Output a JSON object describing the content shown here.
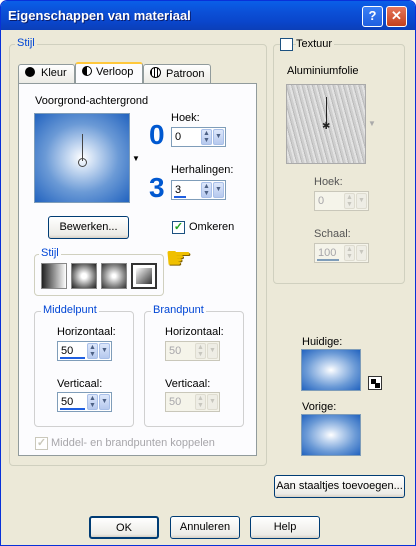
{
  "window": {
    "title": "Eigenschappen van materiaal",
    "help": "?",
    "close": "✕"
  },
  "stijl": {
    "label": "Stijl",
    "tabs": [
      {
        "label": "Kleur",
        "icon": "black-circle-icon"
      },
      {
        "label": "Verloop",
        "icon": "half-circle-icon"
      },
      {
        "label": "Patroon",
        "icon": "pattern-icon"
      }
    ],
    "gradient_name": "Voorgrond-achtergrond",
    "hoek": {
      "label": "Hoek:",
      "value": "0",
      "big": "0"
    },
    "herhalingen": {
      "label": "Herhalingen:",
      "value": "3",
      "big": "3"
    },
    "edit_button": "Bewerken...",
    "omkeren": {
      "label": "Omkeren",
      "checked": true
    },
    "style_group": "Stijl",
    "middelpunt": {
      "label": "Middelpunt",
      "h_label": "Horizontaal:",
      "h_value": "50",
      "v_label": "Verticaal:",
      "v_value": "50"
    },
    "brandpunt": {
      "label": "Brandpunt",
      "h_label": "Horizontaal:",
      "h_value": "50",
      "v_label": "Verticaal:",
      "v_value": "50"
    },
    "link_label": "Middel- en brandpunten koppelen"
  },
  "textuur": {
    "label": "Textuur",
    "checked": false,
    "name": "Aluminiumfolie",
    "hoek_label": "Hoek:",
    "hoek_value": "0",
    "schaal_label": "Schaal:",
    "schaal_value": "100"
  },
  "huidige_label": "Huidige:",
  "vorige_label": "Vorige:",
  "add_swatch_button": "Aan staaltjes toevoegen...",
  "buttons": {
    "ok": "OK",
    "annuleren": "Annuleren",
    "help": "Help"
  },
  "colors": {
    "accent": "#0058d0",
    "title_bar": "#0a5fe8",
    "gradient_dark": "#1f5fb8"
  }
}
